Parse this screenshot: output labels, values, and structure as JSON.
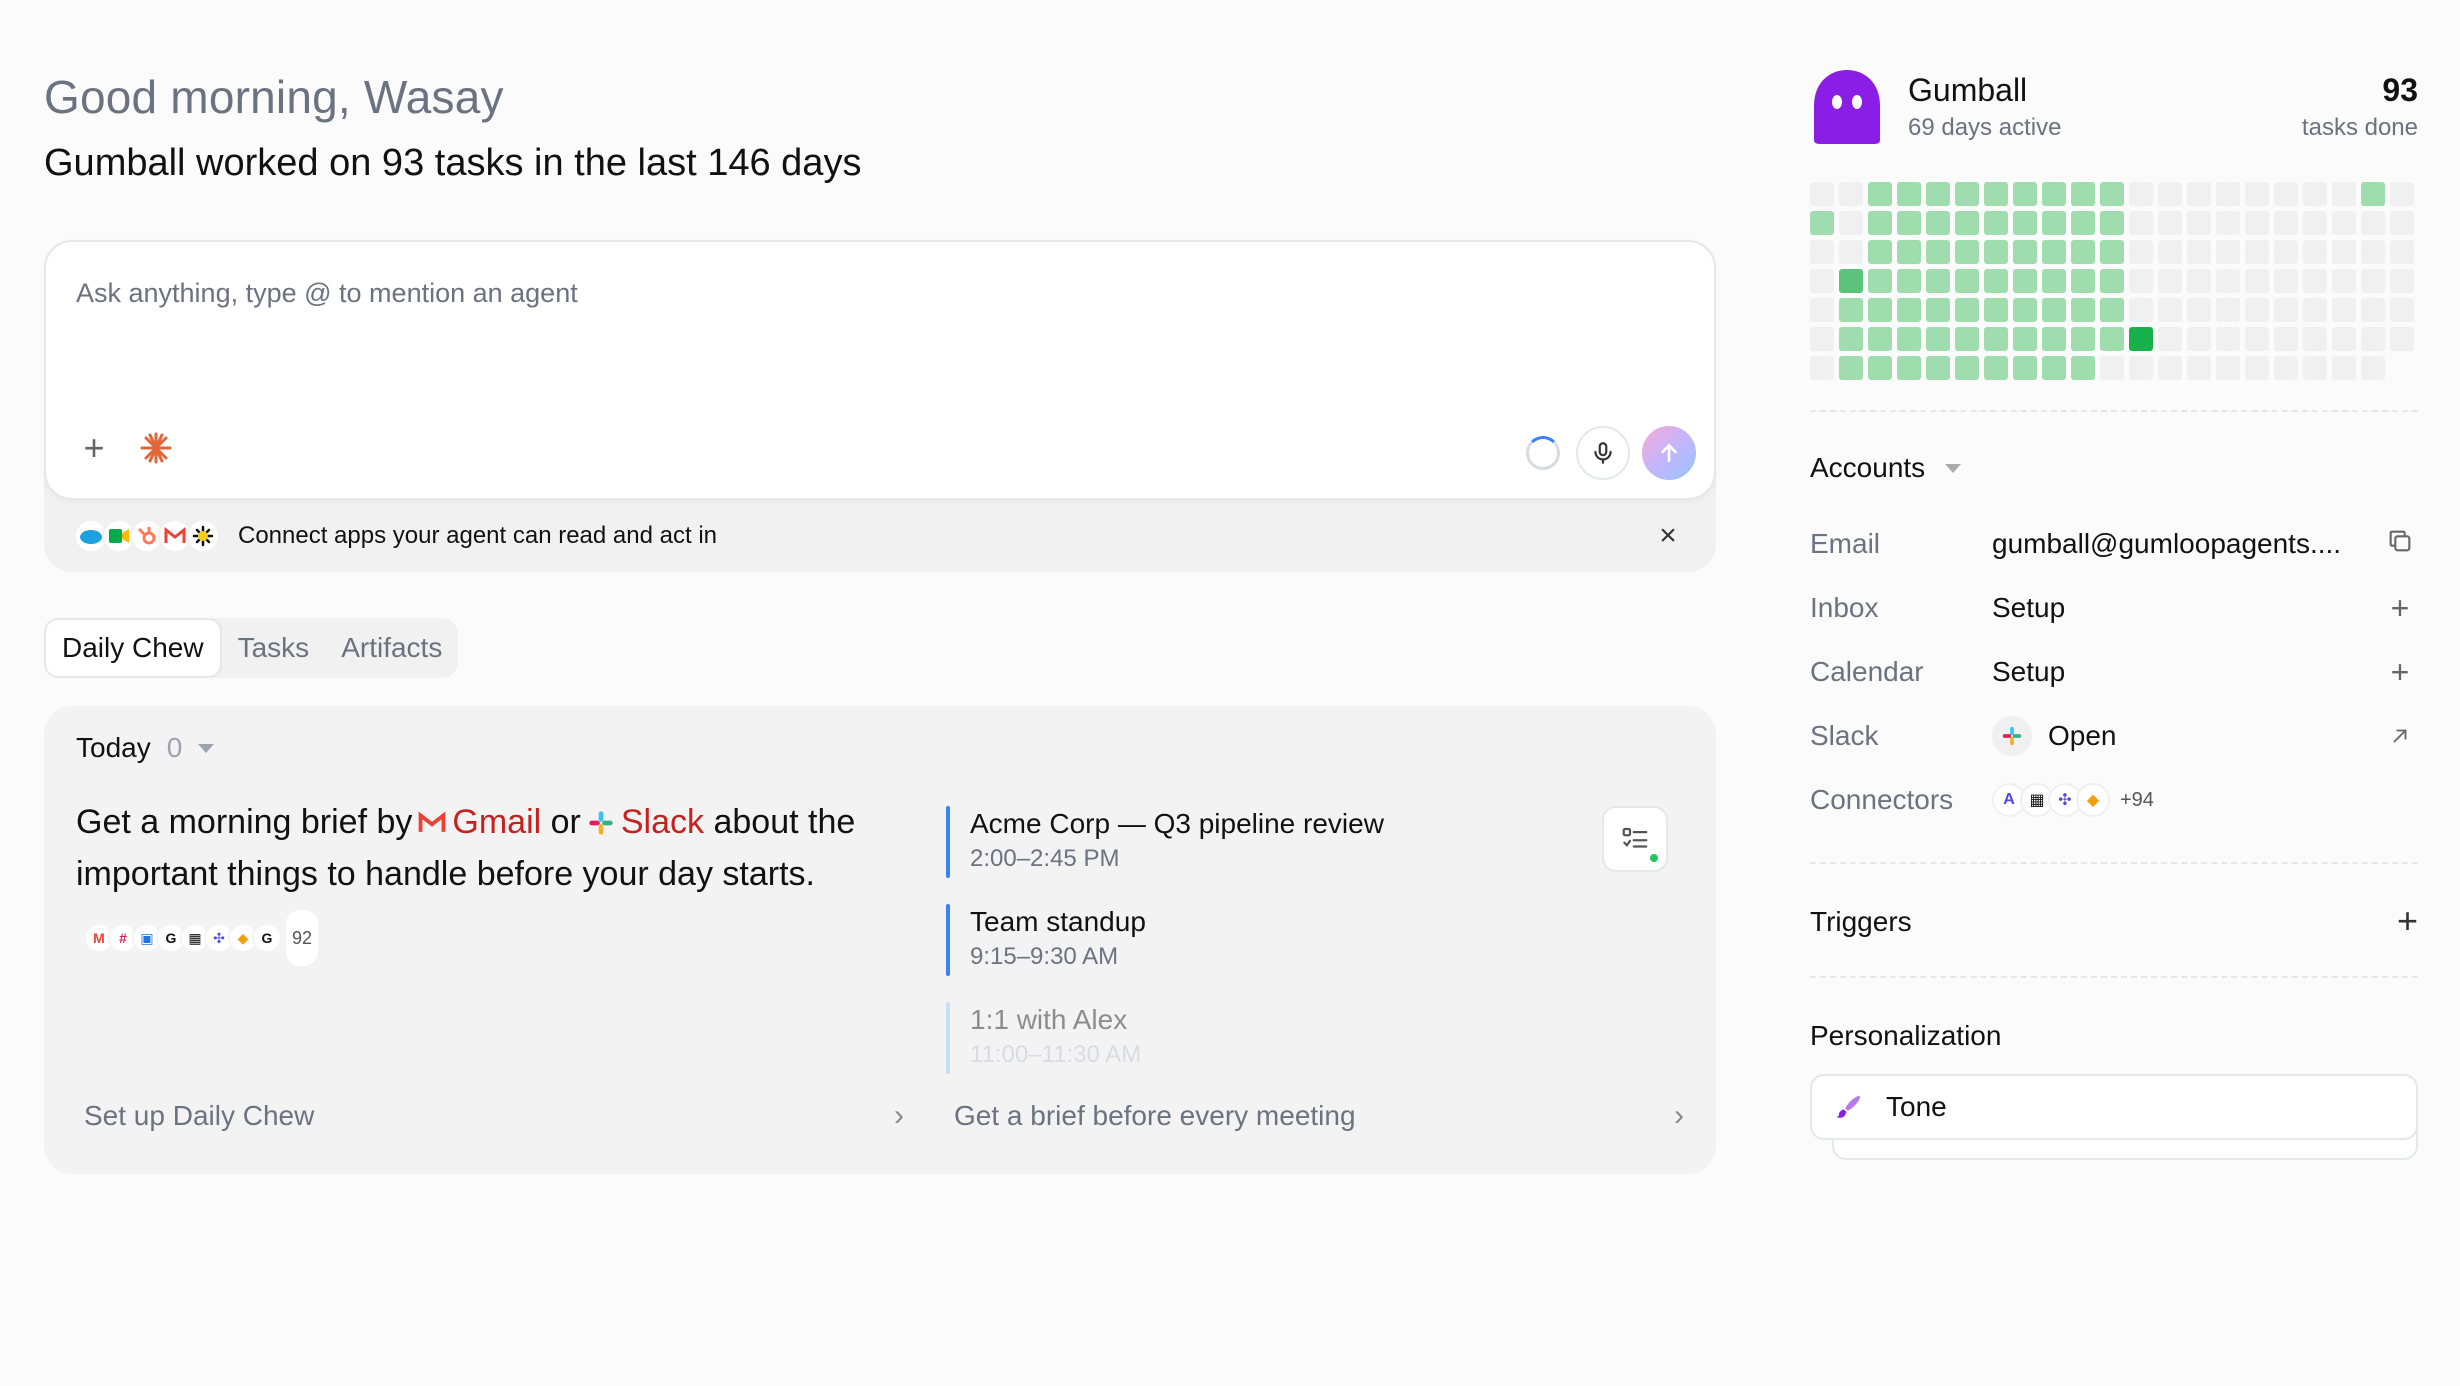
{
  "header": {
    "greeting": "Good morning, Wasay",
    "subtitle": "Gumball worked on 93 tasks in the last 146 days"
  },
  "composer": {
    "placeholder": "Ask anything, type @ to mention an agent",
    "connect_text": "Connect apps your agent can read and act in"
  },
  "tabs": [
    {
      "label": "Daily Chew",
      "active": true
    },
    {
      "label": "Tasks",
      "active": false
    },
    {
      "label": "Artifacts",
      "active": false
    }
  ],
  "card": {
    "today_label": "Today",
    "today_count": "0",
    "brief": {
      "part1": "Get a morning brief by",
      "gmail": "Gmail",
      "or": "or",
      "slack": "Slack",
      "part2": "about the important things to handle before your day starts.",
      "more_count": "92"
    },
    "events": [
      {
        "title": "Acme Corp — Q3 pipeline review",
        "time": "2:00–2:45 PM"
      },
      {
        "title": "Team standup",
        "time": "9:15–9:30 AM"
      },
      {
        "title": "1:1 with Alex",
        "time": "11:00–11:30 AM"
      }
    ],
    "footer_left": "Set up Daily Chew",
    "footer_right": "Get a brief before every meeting"
  },
  "agent": {
    "name": "Gumball",
    "active": "69 days active",
    "tasks_count": "93",
    "tasks_label": "tasks done",
    "avatar_color": "#8b1ee6"
  },
  "heatmap": {
    "rows": 7,
    "cols": 21,
    "levels": [
      [
        0,
        0,
        1,
        1,
        1,
        1,
        1,
        1,
        1,
        1,
        1,
        0,
        0,
        0,
        0,
        0,
        0,
        0,
        0,
        1,
        0
      ],
      [
        1,
        0,
        1,
        1,
        1,
        1,
        1,
        1,
        1,
        1,
        1,
        0,
        0,
        0,
        0,
        0,
        0,
        0,
        0,
        0,
        0
      ],
      [
        0,
        0,
        1,
        1,
        1,
        1,
        1,
        1,
        1,
        1,
        1,
        0,
        0,
        0,
        0,
        0,
        0,
        0,
        0,
        0,
        0
      ],
      [
        0,
        2,
        1,
        1,
        1,
        1,
        1,
        1,
        1,
        1,
        1,
        0,
        0,
        0,
        0,
        0,
        0,
        0,
        0,
        0,
        0
      ],
      [
        0,
        1,
        1,
        1,
        1,
        1,
        1,
        1,
        1,
        1,
        1,
        0,
        0,
        0,
        0,
        0,
        0,
        0,
        0,
        0,
        0
      ],
      [
        0,
        1,
        1,
        1,
        1,
        1,
        1,
        1,
        1,
        1,
        1,
        3,
        0,
        0,
        0,
        0,
        0,
        0,
        0,
        0,
        0
      ],
      [
        0,
        1,
        1,
        1,
        1,
        1,
        1,
        1,
        1,
        1,
        0,
        0,
        0,
        0,
        0,
        0,
        0,
        0,
        0,
        0,
        -1
      ]
    ],
    "colors": {
      "0": "#f0f0f1",
      "1": "#9fdcae",
      "2": "#5cc47a",
      "3": "#18b04a"
    }
  },
  "accounts": {
    "title": "Accounts",
    "rows": [
      {
        "label": "Email",
        "value": "gumball@gumloopagents...."
      },
      {
        "label": "Inbox",
        "value": "Setup"
      },
      {
        "label": "Calendar",
        "value": "Setup"
      },
      {
        "label": "Slack",
        "value": "Open"
      },
      {
        "label": "Connectors",
        "value": "+94"
      }
    ]
  },
  "triggers": {
    "title": "Triggers"
  },
  "personalization": {
    "title": "Personalization",
    "tone_label": "Tone"
  }
}
